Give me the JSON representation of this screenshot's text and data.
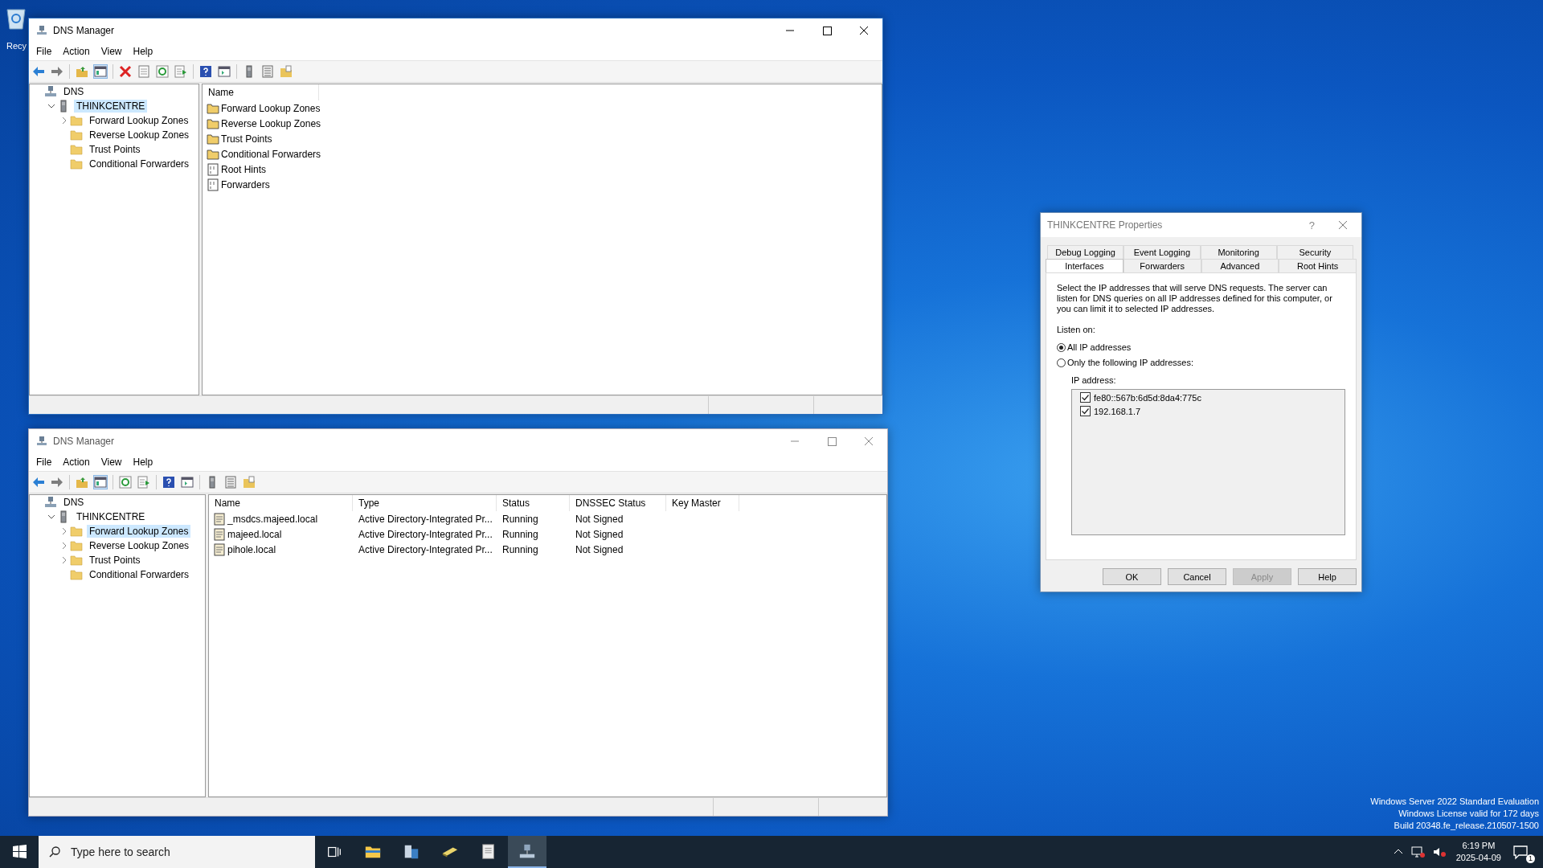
{
  "desktop": {
    "recycle_bin_label": "Recy",
    "watermark": [
      "Windows Server 2022 Standard Evaluation",
      "Windows License valid for 172 days",
      "Build 20348.fe_release.210507-1500"
    ]
  },
  "windows": [
    {
      "title": "DNS Manager",
      "active": true,
      "menu": [
        "File",
        "Action",
        "View",
        "Help"
      ],
      "tree": [
        {
          "label": "DNS",
          "kind": "dns",
          "selected": false,
          "children": [
            {
              "label": "THINKCENTRE",
              "kind": "server",
              "expanded": true,
              "selected": true,
              "children": [
                {
                  "label": "Forward Lookup Zones",
                  "kind": "folder",
                  "expanded": false,
                  "selected": false
                },
                {
                  "label": "Reverse Lookup Zones",
                  "kind": "folder",
                  "selected": false
                },
                {
                  "label": "Trust Points",
                  "kind": "folder",
                  "selected": false
                },
                {
                  "label": "Conditional Forwarders",
                  "kind": "folder",
                  "selected": false
                }
              ]
            }
          ]
        }
      ],
      "list": {
        "columns": [
          "Name"
        ],
        "rows": [
          {
            "kind": "folder",
            "cells": [
              "Forward Lookup Zones"
            ]
          },
          {
            "kind": "folder",
            "cells": [
              "Reverse Lookup Zones"
            ]
          },
          {
            "kind": "folder",
            "cells": [
              "Trust Points"
            ]
          },
          {
            "kind": "folder",
            "cells": [
              "Conditional Forwarders"
            ]
          },
          {
            "kind": "binary",
            "cells": [
              "Root Hints"
            ]
          },
          {
            "kind": "binary",
            "cells": [
              "Forwarders"
            ]
          }
        ]
      }
    },
    {
      "title": "DNS Manager",
      "active": false,
      "menu": [
        "File",
        "Action",
        "View",
        "Help"
      ],
      "tree": [
        {
          "label": "DNS",
          "kind": "dns",
          "selected": false,
          "children": [
            {
              "label": "THINKCENTRE",
              "kind": "server",
              "expanded": true,
              "selected": false,
              "children": [
                {
                  "label": "Forward Lookup Zones",
                  "kind": "folder",
                  "expanded": false,
                  "selected": true
                },
                {
                  "label": "Reverse Lookup Zones",
                  "kind": "folder",
                  "expanded": false,
                  "selected": false
                },
                {
                  "label": "Trust Points",
                  "kind": "folder",
                  "expanded": false,
                  "selected": false
                },
                {
                  "label": "Conditional Forwarders",
                  "kind": "folder",
                  "selected": false
                }
              ]
            }
          ]
        }
      ],
      "list": {
        "columns": [
          "Name",
          "Type",
          "Status",
          "DNSSEC Status",
          "Key Master"
        ],
        "rows": [
          {
            "kind": "zone",
            "cells": [
              "_msdcs.majeed.local",
              "Active Directory-Integrated Pr...",
              "Running",
              "Not Signed"
            ]
          },
          {
            "kind": "zone",
            "cells": [
              "majeed.local",
              "Active Directory-Integrated Pr...",
              "Running",
              "Not Signed"
            ]
          },
          {
            "kind": "zone",
            "cells": [
              "pihole.local",
              "Active Directory-Integrated Pr...",
              "Running",
              "Not Signed"
            ]
          }
        ]
      }
    }
  ],
  "dialog": {
    "title": "THINKCENTRE Properties",
    "help": "?",
    "tab_rows": [
      [
        {
          "label": "Debug Logging",
          "selected": false
        },
        {
          "label": "Event Logging",
          "selected": false
        },
        {
          "label": "Monitoring",
          "selected": false
        },
        {
          "label": "Security",
          "selected": false
        }
      ],
      [
        {
          "label": "Interfaces",
          "selected": true
        },
        {
          "label": "Forwarders",
          "selected": false
        },
        {
          "label": "Advanced",
          "selected": false
        },
        {
          "label": "Root Hints",
          "selected": false
        }
      ]
    ],
    "description": "Select the IP addresses that will serve DNS requests. The server can listen for DNS queries on all IP addresses defined for this computer, or you can limit it to selected IP addresses.",
    "listen_label": "Listen on:",
    "radios": [
      {
        "label": "All IP addresses",
        "selected": true
      },
      {
        "label": "Only the following IP addresses:",
        "selected": false
      }
    ],
    "ip_label": "IP address:",
    "addresses": [
      {
        "label": "fe80::567b:6d5d:8da4:775c",
        "checked": true
      },
      {
        "label": "192.168.1.7",
        "checked": true
      }
    ],
    "buttons": [
      {
        "label": "OK",
        "disabled": false
      },
      {
        "label": "Cancel",
        "disabled": false
      },
      {
        "label": "Apply",
        "disabled": true
      },
      {
        "label": "Help",
        "disabled": false
      }
    ]
  },
  "taskbar": {
    "search": {
      "placeholder": "Type here to search"
    },
    "apps": [
      {
        "kind": "taskview",
        "selected": false
      },
      {
        "kind": "explorer",
        "selected": false
      },
      {
        "kind": "servermanager",
        "selected": false
      },
      {
        "kind": "tool",
        "selected": false
      },
      {
        "kind": "notepad",
        "selected": false
      },
      {
        "kind": "dns",
        "selected": true
      }
    ],
    "time": "6:19 PM",
    "date": "2025-04-09",
    "notification_count": "1"
  }
}
